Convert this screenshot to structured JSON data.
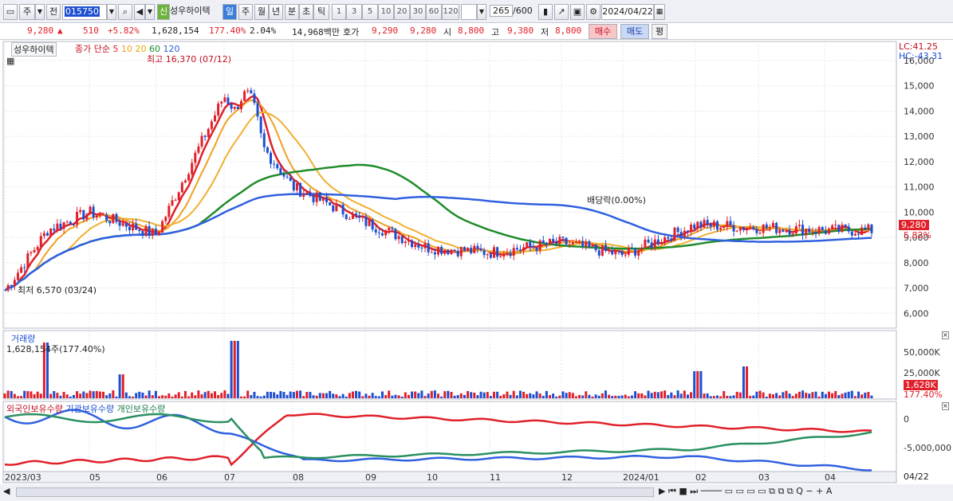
{
  "toolbar": {
    "tab1": "주",
    "tab2": "전",
    "code": "015750",
    "new_badge": "신",
    "stock_name": "성우하이텍",
    "periods": [
      "일",
      "주",
      "월",
      "년",
      "분",
      "초",
      "틱"
    ],
    "intervals": [
      "1",
      "3",
      "5",
      "10",
      "20",
      "30",
      "60",
      "120"
    ],
    "count_value": "265",
    "count_total": "/600",
    "date": "2024/04/22"
  },
  "quote": {
    "price": "9,280",
    "change_arrow": "▲",
    "change": "510",
    "change_pct": "+5.82%",
    "volume": "1,628,154",
    "volume_pct": "177.40%",
    "turnover_pct": "2.04%",
    "amount": "14,968백만",
    "bid_label": "호가",
    "bid": "9,290",
    "ask": "9,280",
    "open_label": "시",
    "open": "8,800",
    "high_label": "고",
    "high": "9,380",
    "low_label": "저",
    "low": "8,800",
    "buy_button": "매수",
    "sell_button": "매도",
    "eval_button": "평"
  },
  "price_panel": {
    "title": "성우하이텍",
    "ma_label": "종가 단순",
    "ma_periods": [
      "5",
      "10",
      "20",
      "60",
      "120"
    ],
    "high_note": "최고 16,370 (07/12)",
    "low_note": "최저 6,570 (03/24)",
    "dividend_note": "배당락(0.00%)",
    "lc": "LC:41.25",
    "hc": "HC:-43.31",
    "last_price": "9,280",
    "last_pct": "5.82%",
    "y_ticks": [
      "16,000",
      "15,000",
      "14,000",
      "13,000",
      "12,000",
      "11,000",
      "10,000",
      "9,000",
      "8,000",
      "7,000",
      "6,000"
    ]
  },
  "volume_panel": {
    "title": "거래량",
    "value_note": "1,628,154주(177.40%)",
    "y_ticks": [
      "50,000K",
      "25,000K"
    ],
    "last_volume": "1,628K",
    "last_pct": "177.40%"
  },
  "holdings_panel": {
    "legend": [
      "외국인보유수량",
      "기관보유수량",
      "개인보유수량"
    ],
    "y_ticks": [
      "0",
      "-5,000,000"
    ]
  },
  "x_axis": {
    "labels": [
      "2023/03",
      "05",
      "06",
      "07",
      "08",
      "09",
      "10",
      "11",
      "12",
      "2024/01",
      "02",
      "03",
      "04"
    ],
    "right_label": "04/22"
  },
  "colors": {
    "up": "#e0202a",
    "down": "#1d4fd0",
    "ma5": "#e0202a",
    "ma10": "#f0a020",
    "ma20": "#f0b030",
    "ma60": "#1f8c2a",
    "ma120": "#3060e0",
    "foreign": "#e0202a",
    "institution": "#3060e0",
    "individual": "#2a9060"
  },
  "chart_data": {
    "type": "candlestick",
    "y_range": [
      5600,
      16500
    ],
    "ma_close": [
      {
        "month": "2023/03",
        "close": 6900
      },
      {
        "month": "2023/04",
        "close": 9300
      },
      {
        "month": "2023/05",
        "close": 10000
      },
      {
        "month": "2023/06",
        "close": 9100
      },
      {
        "month": "2023/07",
        "close": 14600
      },
      {
        "month": "2023/08",
        "close": 11000
      },
      {
        "month": "2023/09",
        "close": 9600
      },
      {
        "month": "2023/10",
        "close": 8600
      },
      {
        "month": "2023/11",
        "close": 8400
      },
      {
        "month": "2023/12",
        "close": 8800
      },
      {
        "month": "2024/01",
        "close": 8300
      },
      {
        "month": "2024/02",
        "close": 9500
      },
      {
        "month": "2024/03",
        "close": 9400
      },
      {
        "month": "2024/04",
        "close": 9280
      }
    ]
  }
}
